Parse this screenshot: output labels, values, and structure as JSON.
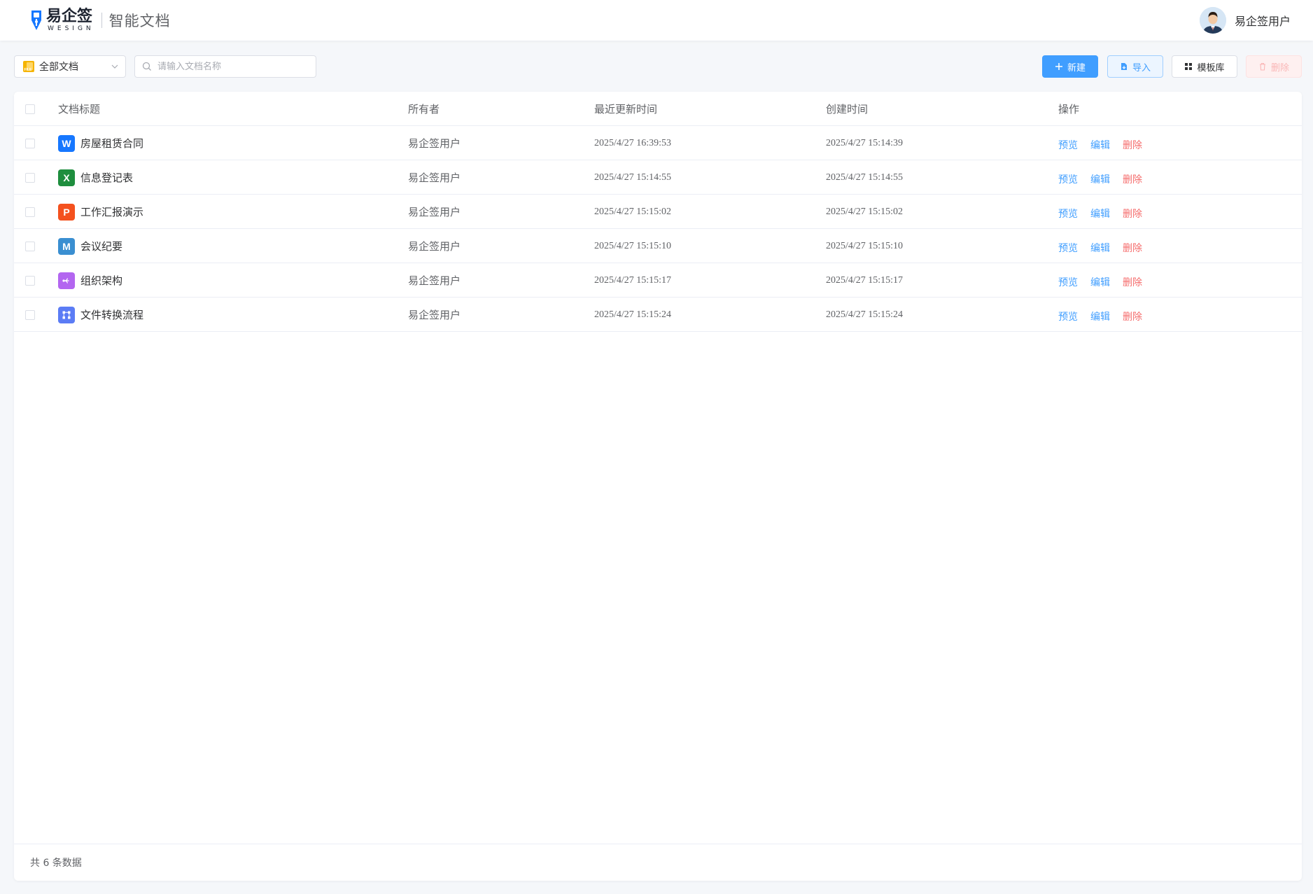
{
  "header": {
    "logo_cn": "易企签",
    "logo_en": "WESIGN",
    "app_title": "智能文档",
    "username": "易企签用户"
  },
  "toolbar": {
    "filter_label": "全部文档",
    "search_placeholder": "请输入文档名称",
    "new_label": "新建",
    "import_label": "导入",
    "template_label": "模板库",
    "delete_label": "删除"
  },
  "table": {
    "headers": {
      "title": "文档标题",
      "owner": "所有者",
      "updated": "最近更新时间",
      "created": "创建时间",
      "actions": "操作"
    },
    "actions": {
      "preview": "预览",
      "edit": "编辑",
      "delete": "删除"
    },
    "rows": [
      {
        "icon": "W",
        "icon_name": "word-icon",
        "icon_color": "#1677ff",
        "title": "房屋租赁合同",
        "owner": "易企签用户",
        "updated": "2025/4/27 16:39:53",
        "created": "2025/4/27 15:14:39"
      },
      {
        "icon": "X",
        "icon_name": "excel-icon",
        "icon_color": "#1e8e3e",
        "title": "信息登记表",
        "owner": "易企签用户",
        "updated": "2025/4/27 15:14:55",
        "created": "2025/4/27 15:14:55"
      },
      {
        "icon": "P",
        "icon_name": "ppt-icon",
        "icon_color": "#f4511e",
        "title": "工作汇报演示",
        "owner": "易企签用户",
        "updated": "2025/4/27 15:15:02",
        "created": "2025/4/27 15:15:02"
      },
      {
        "icon": "M",
        "icon_name": "markdown-icon",
        "icon_color": "#3a8fd1",
        "title": "会议纪要",
        "owner": "易企签用户",
        "updated": "2025/4/27 15:15:10",
        "created": "2025/4/27 15:15:10"
      },
      {
        "icon": "",
        "icon_name": "mindmap-icon",
        "icon_color": "#b366f0",
        "title": "组织架构",
        "owner": "易企签用户",
        "updated": "2025/4/27 15:15:17",
        "created": "2025/4/27 15:15:17"
      },
      {
        "icon": "",
        "icon_name": "flowchart-icon",
        "icon_color": "#5b7cf5",
        "title": "文件转换流程",
        "owner": "易企签用户",
        "updated": "2025/4/27 15:15:24",
        "created": "2025/4/27 15:15:24"
      }
    ]
  },
  "footer": {
    "total": "共 6 条数据"
  },
  "colors": {
    "primary": "#409eff",
    "danger": "#f56c6c"
  }
}
